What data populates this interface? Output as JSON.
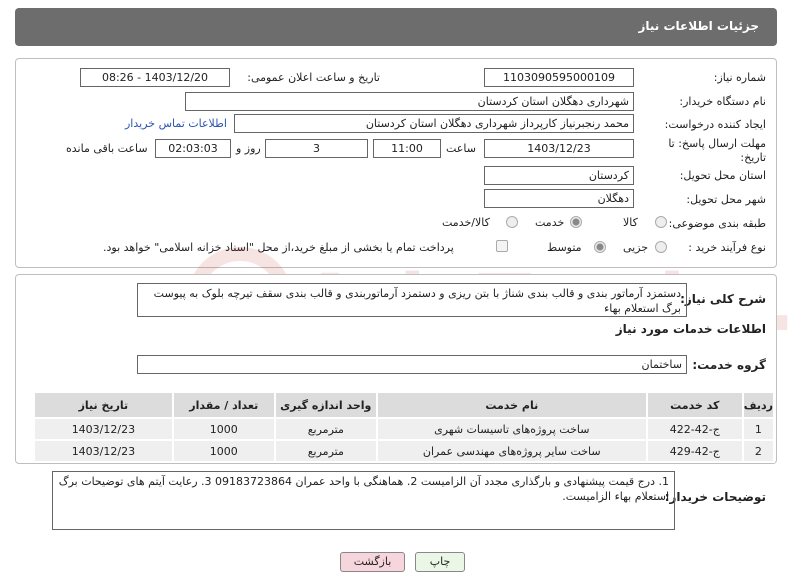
{
  "header": {
    "title": "جزئیات اطلاعات نیاز"
  },
  "form": {
    "need_number": {
      "label": "شماره نیاز:",
      "value": "1103090595000109"
    },
    "announce_datetime": {
      "label": "تاریخ و ساعت اعلان عمومی:",
      "value": "1403/12/20 - 08:26"
    },
    "buyer_org": {
      "label": "نام دستگاه خریدار:",
      "value": "شهرداری دهگلان استان کردستان"
    },
    "requester": {
      "label": "ایجاد کننده درخواست:",
      "value": "محمد رنجبرنیاز کارپرداز شهرداری دهگلان استان کردستان",
      "contact_link": "اطلاعات تماس خریدار"
    },
    "deadline": {
      "label_line1": "مهلت ارسال پاسخ: تا",
      "label_line2": "تاریخ:",
      "date": "1403/12/23",
      "time_label": "ساعت",
      "time": "11:00",
      "days": "3",
      "days_label": "روز و",
      "remaining": "02:03:03",
      "remaining_label": "ساعت باقی مانده"
    },
    "province": {
      "label": "استان محل تحویل:",
      "value": "کردستان"
    },
    "city": {
      "label": "شهر محل تحویل:",
      "value": "دهگلان"
    },
    "category": {
      "label": "طبقه بندی موضوعی:",
      "options": [
        "کالا",
        "خدمت",
        "کالا/خدمت"
      ],
      "selected": "خدمت"
    },
    "purchase_type": {
      "label": "نوع فرآیند خرید :",
      "options": [
        "جزیی",
        "متوسط"
      ],
      "selected": "متوسط",
      "treasury_note": "پرداخت تمام یا بخشی از مبلغ خرید،از محل \"اسناد خزانه اسلامی\" خواهد بود."
    }
  },
  "summary": {
    "label": "شرح کلی نیاز:",
    "text": "دستمزد آرماتور بندی و قالب بندی شناژ با بتن ریزی و دستمزد آرماتوربندی و قالب بندی سقف تیرچه بلوک به پیوست برگ استعلام بهاء"
  },
  "services": {
    "section_title": "اطلاعات خدمات مورد نیاز",
    "group_label": "گروه خدمت:",
    "group_value": "ساختمان",
    "columns": [
      "ردیف",
      "کد خدمت",
      "نام خدمت",
      "واحد اندازه گیری",
      "تعداد / مقدار",
      "تاریخ نیاز"
    ],
    "rows": [
      {
        "row": "1",
        "code": "ج-42-422",
        "name": "ساخت پروژه‌های تاسیسات شهری",
        "unit": "مترمربع",
        "qty": "1000",
        "date": "1403/12/23"
      },
      {
        "row": "2",
        "code": "ج-42-429",
        "name": "ساخت سایر پروژه‌های مهندسی عمران",
        "unit": "مترمربع",
        "qty": "1000",
        "date": "1403/12/23"
      }
    ]
  },
  "buyer_notes": {
    "label": "توضیحات خریدار:",
    "text": "1. درج قیمت پیشنهادی و بارگذاری مجدد آن الزامیست 2. هماهنگی با واحد عمران 09183723864  3. رعایت آیتم های توضیحات برگ استعلام بهاء الزامیست."
  },
  "buttons": {
    "print": "چاپ",
    "back": "بازگشت"
  },
  "watermark": {
    "text": "AriaTender.neT"
  },
  "colors": {
    "header": "#6d6d6d",
    "link": "#2a55b0",
    "back_button": "#f6d6dc",
    "print_button": "#eaf6e6",
    "watermark": "#c0392b"
  }
}
